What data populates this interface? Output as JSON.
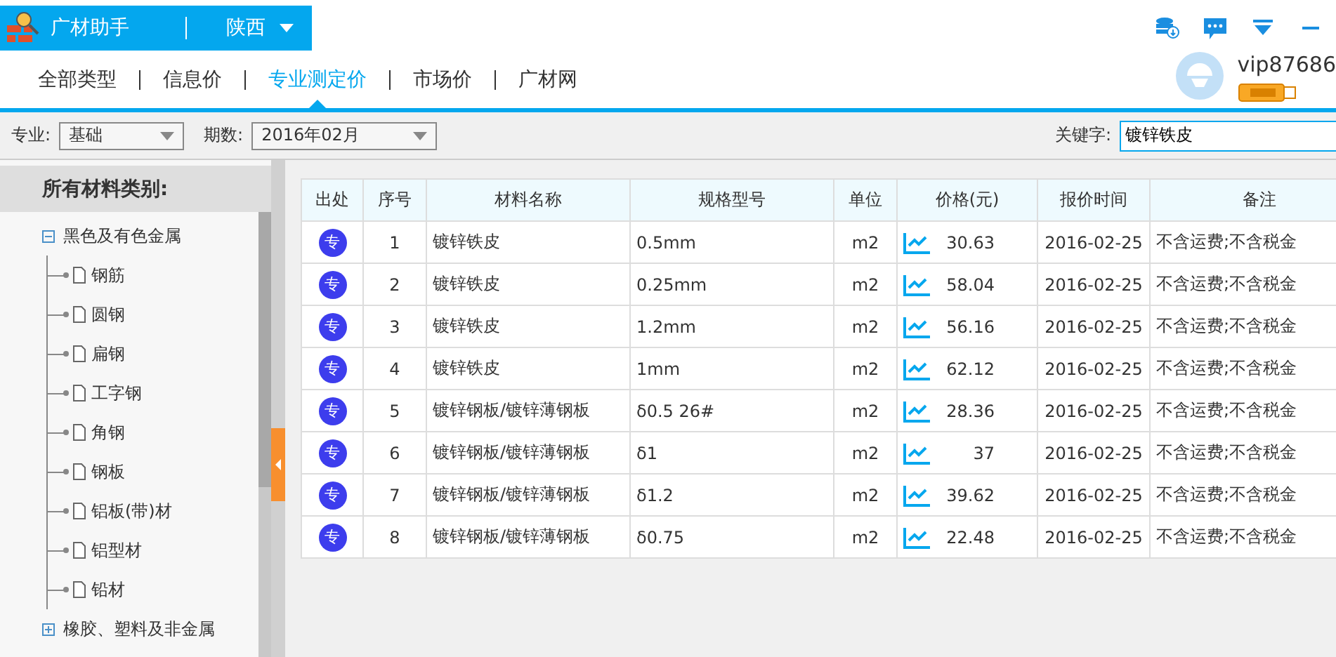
{
  "app": {
    "title": "广材助手",
    "region": "陕西"
  },
  "tabs": [
    {
      "label": "全部类型",
      "selected": false
    },
    {
      "label": "信息价",
      "selected": false
    },
    {
      "label": "专业测定价",
      "selected": true
    },
    {
      "label": "市场价",
      "selected": false
    },
    {
      "label": "广材网",
      "selected": false
    }
  ],
  "user": {
    "name": "vip87686"
  },
  "filters": {
    "specialty_label": "专业:",
    "specialty": "基础",
    "period_label": "期数:",
    "period": "2016年02月",
    "keyword_label": "关键字:",
    "keyword": "镀锌铁皮"
  },
  "sidebar": {
    "title": "所有材料类别:",
    "tree": [
      {
        "label": "黑色及有色金属",
        "expanded": true,
        "children": [
          {
            "label": "钢筋"
          },
          {
            "label": "圆钢"
          },
          {
            "label": "扁钢"
          },
          {
            "label": "工字钢"
          },
          {
            "label": "角钢"
          },
          {
            "label": "钢板"
          },
          {
            "label": "铝板(带)材"
          },
          {
            "label": "铝型材"
          },
          {
            "label": "铅材"
          }
        ]
      },
      {
        "label": "橡胶、塑料及非金属",
        "expanded": false
      }
    ]
  },
  "table": {
    "columns": [
      "出处",
      "序号",
      "材料名称",
      "规格型号",
      "单位",
      "价格(元)",
      "报价时间",
      "备注"
    ],
    "rows": [
      {
        "source": "专",
        "no": "1",
        "name": "镀锌铁皮",
        "spec": "0.5mm",
        "unit": "m2",
        "price": "30.63",
        "date": "2016-02-25",
        "note": "不含运费;不含税金"
      },
      {
        "source": "专",
        "no": "2",
        "name": "镀锌铁皮",
        "spec": "0.25mm",
        "unit": "m2",
        "price": "58.04",
        "date": "2016-02-25",
        "note": "不含运费;不含税金"
      },
      {
        "source": "专",
        "no": "3",
        "name": "镀锌铁皮",
        "spec": "1.2mm",
        "unit": "m2",
        "price": "56.16",
        "date": "2016-02-25",
        "note": "不含运费;不含税金"
      },
      {
        "source": "专",
        "no": "4",
        "name": "镀锌铁皮",
        "spec": "1mm",
        "unit": "m2",
        "price": "62.12",
        "date": "2016-02-25",
        "note": "不含运费;不含税金"
      },
      {
        "source": "专",
        "no": "5",
        "name": "镀锌钢板/镀锌薄钢板",
        "spec": "δ0.5 26#",
        "unit": "m2",
        "price": "28.36",
        "date": "2016-02-25",
        "note": "不含运费;不含税金"
      },
      {
        "source": "专",
        "no": "6",
        "name": "镀锌钢板/镀锌薄钢板",
        "spec": "δ1",
        "unit": "m2",
        "price": "37",
        "date": "2016-02-25",
        "note": "不含运费;不含税金"
      },
      {
        "source": "专",
        "no": "7",
        "name": "镀锌钢板/镀锌薄钢板",
        "spec": "δ1.2",
        "unit": "m2",
        "price": "39.62",
        "date": "2016-02-25",
        "note": "不含运费;不含税金"
      },
      {
        "source": "专",
        "no": "8",
        "name": "镀锌钢板/镀锌薄钢板",
        "spec": "δ0.75",
        "unit": "m2",
        "price": "22.48",
        "date": "2016-02-25",
        "note": "不含运费;不含税金"
      }
    ]
  }
}
